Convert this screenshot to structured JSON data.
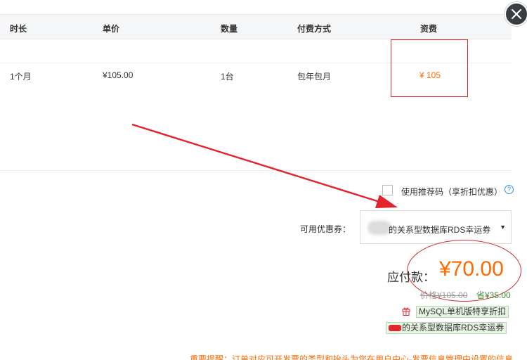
{
  "table": {
    "headers": [
      "时长",
      "单价",
      "数量",
      "付费方式",
      "资费"
    ],
    "row": {
      "duration": "1个月",
      "unit_price": "¥105.00",
      "quantity": "1台",
      "payment": "包年包月",
      "fee": "¥ 105"
    }
  },
  "recommend": {
    "label": "使用推荐码（享折扣优惠）",
    "help_icon": "question-circle-icon",
    "checked": false
  },
  "coupon": {
    "label": "可用优惠券：",
    "selected": "的关系型数据库RDS幸运券（"
  },
  "summary": {
    "due_label": "应付款：",
    "due_amount": "¥70.00",
    "original_price": "价格¥105.00",
    "saved": "省¥35.00"
  },
  "promos": [
    "MySQL单机版特享折扣",
    "的关系型数据库RDS幸运券"
  ],
  "notice": "重要提醒：订单对应可开发票的类型和抬头为您在用户中心-发票信息管理中设置的信息",
  "colors": {
    "accent": "#ff6a00",
    "annotation_red": "#d62c2c",
    "saved_green": "#3c8a2e"
  }
}
